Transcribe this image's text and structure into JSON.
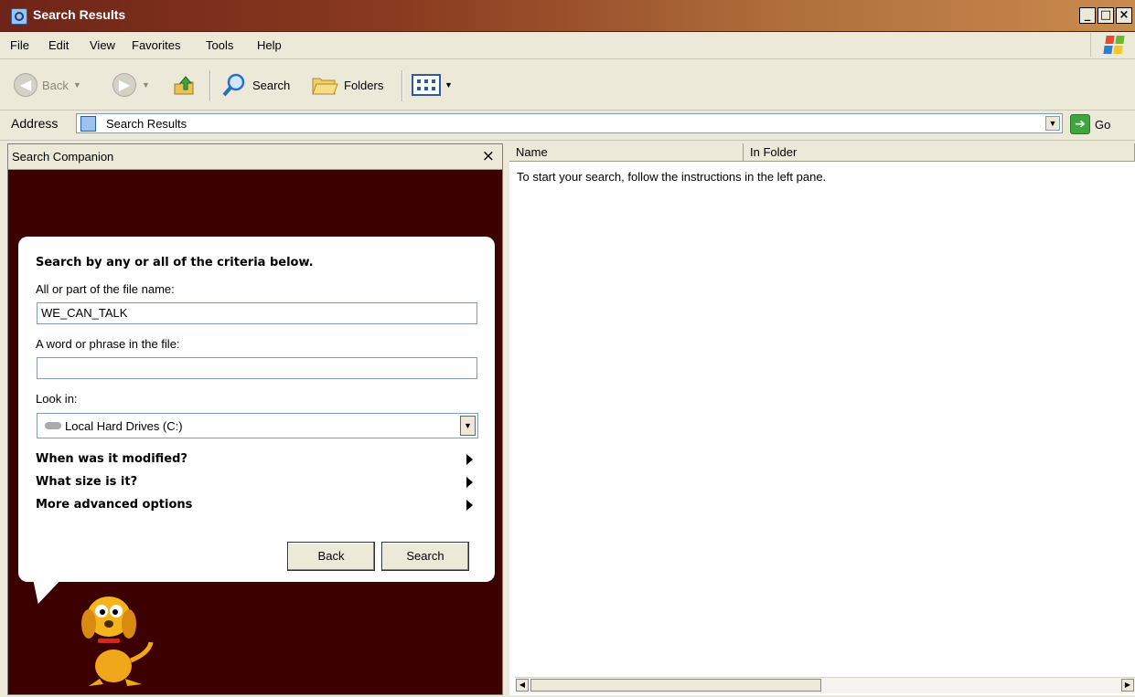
{
  "window": {
    "title": "Search Results",
    "controls": [
      "_",
      "□",
      "×"
    ]
  },
  "menu": [
    "File",
    "Edit",
    "View",
    "Favorites",
    "Tools",
    "Help"
  ],
  "toolbar": {
    "back": "Back",
    "search": "Search",
    "folders": "Folders"
  },
  "address": {
    "label": "Address",
    "value": "Search Results",
    "go": "Go"
  },
  "companion": {
    "title": "Search Companion",
    "close": "×",
    "heading": "Search by any or all of the criteria below.",
    "filename_label": "All or part of the file name:",
    "filename_value": "WE_CAN_TALK",
    "phrase_label": "A word or phrase in the file:",
    "phrase_value": "",
    "lookin_label": "Look in:",
    "lookin_value": "Local Hard Drives (C:)",
    "options": [
      "When was it modified?",
      "What size is it?",
      "More advanced options"
    ],
    "back_button": "Back",
    "search_button": "Search"
  },
  "results": {
    "columns": [
      "Name",
      "In Folder"
    ],
    "empty_message": "To start your search, follow the instructions in the left pane."
  }
}
